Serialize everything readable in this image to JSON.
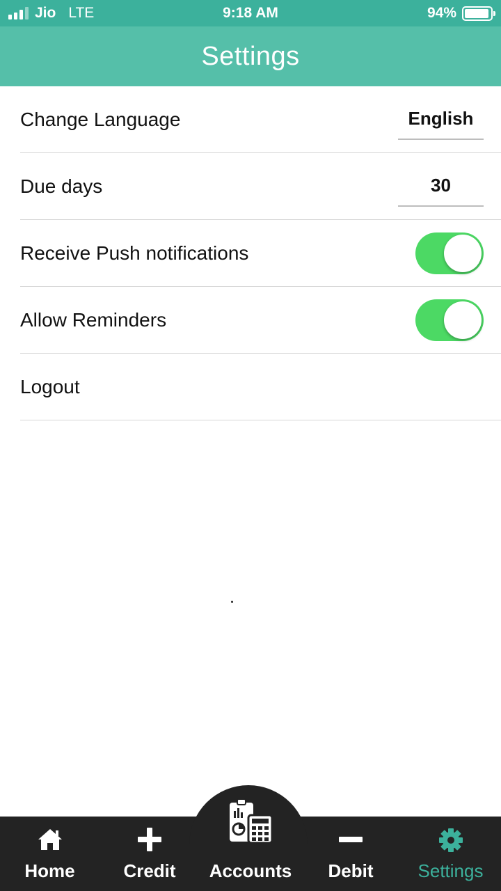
{
  "status_bar": {
    "carrier": "Jio",
    "network": "LTE",
    "time": "9:18 AM",
    "battery": "94%"
  },
  "header": {
    "title": "Settings"
  },
  "settings": {
    "language": {
      "label": "Change Language",
      "value": "English"
    },
    "due_days": {
      "label": "Due days",
      "value": "30"
    },
    "push": {
      "label": "Receive Push notifications",
      "enabled": true
    },
    "reminders": {
      "label": "Allow Reminders",
      "enabled": true
    },
    "logout": {
      "label": "Logout"
    }
  },
  "tabs": [
    {
      "label": "Home",
      "icon": "home-icon"
    },
    {
      "label": "Credit",
      "icon": "plus-icon"
    },
    {
      "label": "Accounts",
      "icon": "accounts-calculator-icon"
    },
    {
      "label": "Debit",
      "icon": "minus-icon"
    },
    {
      "label": "Settings",
      "icon": "gear-icon",
      "active": true
    }
  ],
  "colors": {
    "status_bar": "#3cb19c",
    "header": "#55bfa9",
    "toggle_on": "#4cd964",
    "tab_bar": "#232323",
    "tab_active": "#3cb19c"
  }
}
